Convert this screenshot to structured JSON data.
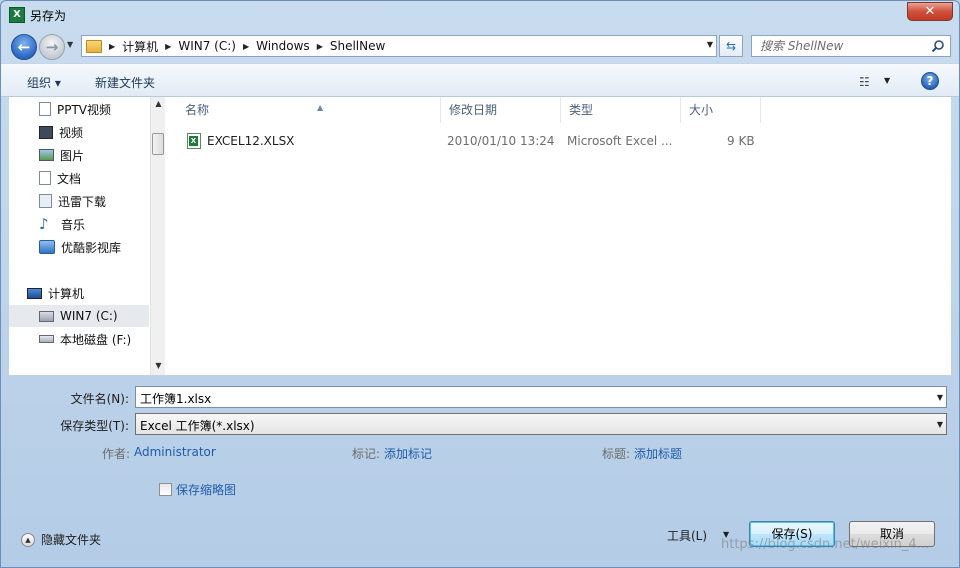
{
  "window": {
    "title": "另存为",
    "close_label": "✕"
  },
  "address": {
    "crumbs": [
      "计算机",
      "WIN7 (C:)",
      "Windows",
      "ShellNew"
    ],
    "search_placeholder": "搜索 ShellNew"
  },
  "toolbar": {
    "organize_label": "组织 ▾",
    "new_folder_label": "新建文件夹",
    "help_label": "?"
  },
  "nav": {
    "favorites": [
      {
        "label": "PPTV视频",
        "icon": "video-file-icon"
      },
      {
        "label": "视频",
        "icon": "film-icon"
      },
      {
        "label": "图片",
        "icon": "picture-icon"
      },
      {
        "label": "文档",
        "icon": "document-icon"
      },
      {
        "label": "迅雷下载",
        "icon": "download-folder-icon"
      },
      {
        "label": "音乐",
        "icon": "music-icon"
      },
      {
        "label": "优酷影视库",
        "icon": "media-library-icon"
      }
    ],
    "computer_label": "计算机",
    "drives": [
      {
        "label": "WIN7 (C:)",
        "selected": true
      },
      {
        "label": "本地磁盘 (F:)",
        "selected": false
      }
    ]
  },
  "columns": {
    "name": "名称",
    "modified": "修改日期",
    "type": "类型",
    "size": "大小"
  },
  "files": [
    {
      "name": "EXCEL12.XLSX",
      "modified": "2010/01/10 13:24",
      "type": "Microsoft Excel ...",
      "size": "9 KB"
    }
  ],
  "form": {
    "filename_label": "文件名(N):",
    "filename_value": "工作簿1.xlsx",
    "filetype_label": "保存类型(T):",
    "filetype_value": "Excel 工作簿(*.xlsx)",
    "author_label": "作者:",
    "author_value": "Administrator",
    "tags_label": "标记:",
    "tags_value": "添加标记",
    "title_label": "标题:",
    "title_value": "添加标题",
    "thumbnail_label": "保存缩略图"
  },
  "footer": {
    "hide_folders_label": "隐藏文件夹",
    "tools_label": "工具(L)",
    "save_label": "保存(S)",
    "cancel_label": "取消"
  },
  "watermark": "https://blog.csdn.net/weixin_4..."
}
